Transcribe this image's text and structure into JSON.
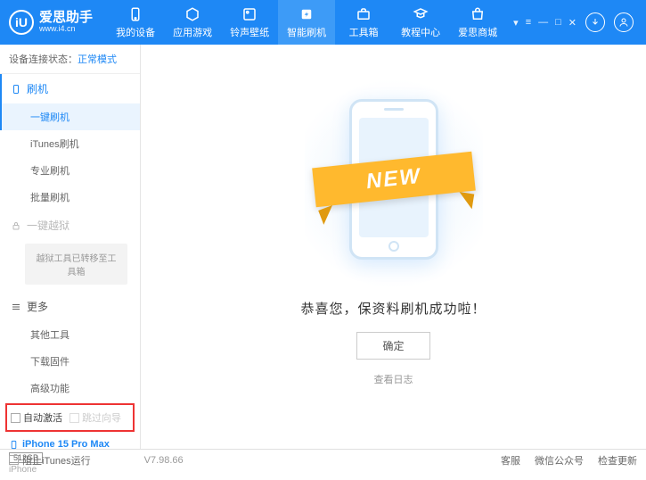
{
  "header": {
    "app_name": "爱思助手",
    "app_url": "www.i4.cn",
    "logo_letter": "iU",
    "nav": [
      {
        "label": "我的设备"
      },
      {
        "label": "应用游戏"
      },
      {
        "label": "铃声壁纸"
      },
      {
        "label": "智能刷机"
      },
      {
        "label": "工具箱"
      },
      {
        "label": "教程中心"
      },
      {
        "label": "爱思商城"
      }
    ]
  },
  "sidebar": {
    "status_label": "设备连接状态：",
    "status_value": "正常模式",
    "section_flash": "刷机",
    "items_flash": [
      "一键刷机",
      "iTunes刷机",
      "专业刷机",
      "批量刷机"
    ],
    "section_jail": "一键越狱",
    "jail_note": "越狱工具已转移至工具箱",
    "section_more": "更多",
    "items_more": [
      "其他工具",
      "下载固件",
      "高级功能"
    ],
    "cb_auto": "自动激活",
    "cb_skip": "跳过向导",
    "device": {
      "name": "iPhone 15 Pro Max",
      "storage": "512GB",
      "type": "iPhone"
    }
  },
  "main": {
    "ribbon": "NEW",
    "message": "恭喜您，保资料刷机成功啦！",
    "ok": "确定",
    "view_log": "查看日志"
  },
  "footer": {
    "block_itunes": "阻止iTunes运行",
    "version": "V7.98.66",
    "links": [
      "客服",
      "微信公众号",
      "检查更新"
    ]
  }
}
